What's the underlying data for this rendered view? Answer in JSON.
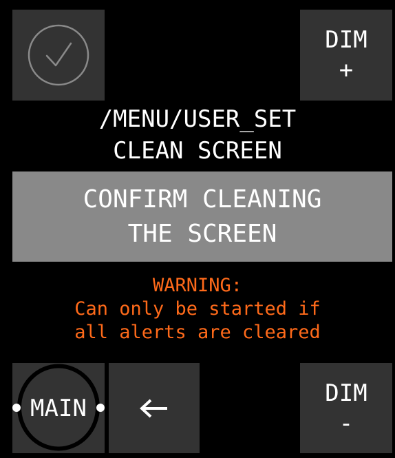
{
  "header": {
    "confirm_icon": "check-circle-icon",
    "dim_up": {
      "label": "DIM",
      "sign": "+"
    }
  },
  "title": {
    "path": "/MENU/USER_SET",
    "name": "CLEAN SCREEN"
  },
  "confirm": {
    "line1": "CONFIRM CLEANING",
    "line2": "THE SCREEN"
  },
  "warning": {
    "line1": "WARNING:",
    "line2": "Can only be started if",
    "line3": "all alerts are cleared",
    "color": "#ff6a1a"
  },
  "footer": {
    "main_label": "MAIN",
    "back_icon": "arrow-left-icon",
    "dim_down": {
      "label": "DIM",
      "sign": "-"
    }
  },
  "colors": {
    "background": "#000000",
    "tile": "#333333",
    "panel": "#898989"
  }
}
